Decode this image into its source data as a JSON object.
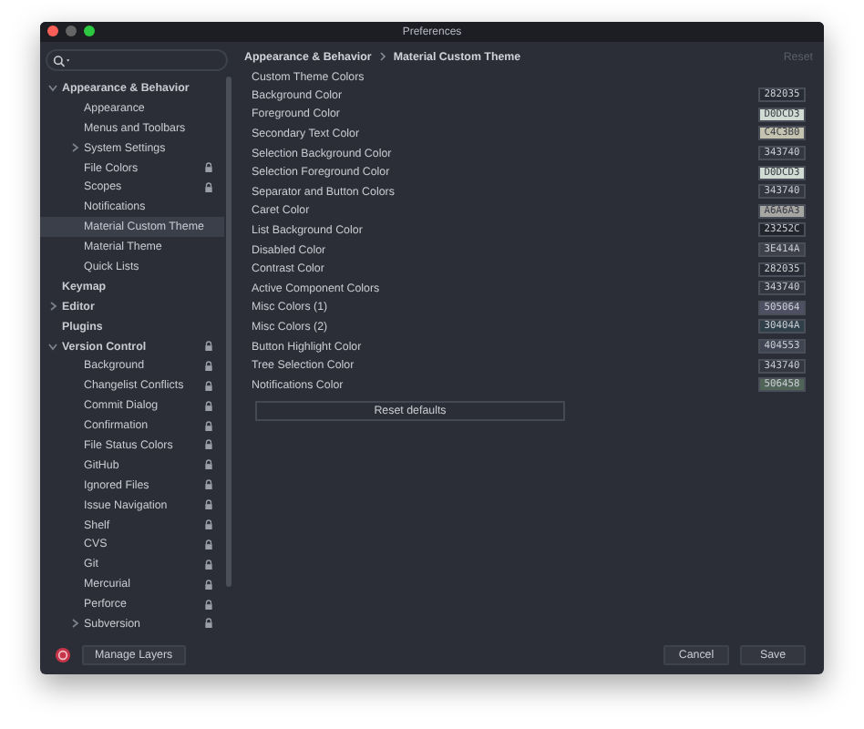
{
  "window": {
    "title": "Preferences"
  },
  "tree": [
    {
      "label": "Appearance & Behavior",
      "expanded": true,
      "selected": false,
      "shared": false,
      "children": [
        {
          "label": "Appearance",
          "selected": false,
          "shared": false
        },
        {
          "label": "Menus and Toolbars",
          "selected": false,
          "shared": false
        },
        {
          "label": "System Settings",
          "expanded": false,
          "selected": false,
          "shared": false
        },
        {
          "label": "File Colors",
          "selected": false,
          "shared": true
        },
        {
          "label": "Scopes",
          "selected": false,
          "shared": true
        },
        {
          "label": "Notifications",
          "selected": false,
          "shared": false
        },
        {
          "label": "Material Custom Theme",
          "selected": true,
          "shared": false
        },
        {
          "label": "Material Theme",
          "selected": false,
          "shared": false
        },
        {
          "label": "Quick Lists",
          "selected": false,
          "shared": false
        }
      ]
    },
    {
      "label": "Keymap",
      "selected": false,
      "shared": false
    },
    {
      "label": "Editor",
      "expanded": false,
      "selected": false,
      "shared": false
    },
    {
      "label": "Plugins",
      "selected": false,
      "shared": false
    },
    {
      "label": "Version Control",
      "expanded": true,
      "selected": false,
      "shared": true,
      "children": [
        {
          "label": "Background",
          "selected": false,
          "shared": true
        },
        {
          "label": "Changelist Conflicts",
          "selected": false,
          "shared": true
        },
        {
          "label": "Commit Dialog",
          "selected": false,
          "shared": true
        },
        {
          "label": "Confirmation",
          "selected": false,
          "shared": true
        },
        {
          "label": "File Status Colors",
          "selected": false,
          "shared": true
        },
        {
          "label": "GitHub",
          "selected": false,
          "shared": true
        },
        {
          "label": "Ignored Files",
          "selected": false,
          "shared": true
        },
        {
          "label": "Issue Navigation",
          "selected": false,
          "shared": true
        },
        {
          "label": "Shelf",
          "selected": false,
          "shared": true
        },
        {
          "label": "CVS",
          "selected": false,
          "shared": true
        },
        {
          "label": "Git",
          "selected": false,
          "shared": true
        },
        {
          "label": "Mercurial",
          "selected": false,
          "shared": true
        },
        {
          "label": "Perforce",
          "selected": false,
          "shared": true
        },
        {
          "label": "Subversion",
          "expanded": false,
          "selected": false,
          "shared": true
        }
      ]
    }
  ],
  "breadcrumb": [
    "Appearance & Behavior",
    "Material Custom Theme"
  ],
  "reset": {
    "label": "Reset",
    "disabled": true
  },
  "section_title": "Custom Theme Colors",
  "colors": [
    {
      "label": "Background Color",
      "value": "282035",
      "color": "#282d35"
    },
    {
      "label": "Foreground Color",
      "value": "D0DCD3",
      "color": "#d0dcd3"
    },
    {
      "label": "Secondary Text Color",
      "value": "C4C3B0",
      "color": "#c4c3b0"
    },
    {
      "label": "Selection Background Color",
      "value": "343740",
      "color": "#343740"
    },
    {
      "label": "Selection Foreground Color",
      "value": "D0DCD3",
      "color": "#d0dcd3"
    },
    {
      "label": "Separator and Button Colors",
      "value": "343740",
      "color": "#343740"
    },
    {
      "label": "Caret Color",
      "value": "A6A6A3",
      "color": "#a6a6a3"
    },
    {
      "label": "List Background Color",
      "value": "23252C",
      "color": "#23252c"
    },
    {
      "label": "Disabled Color",
      "value": "3E414A",
      "color": "#3e414a"
    },
    {
      "label": "Contrast Color",
      "value": "282035",
      "color": "#282d35"
    },
    {
      "label": "Active Component Colors",
      "value": "343740",
      "color": "#343740"
    },
    {
      "label": "Misc Colors (1)",
      "value": "505064",
      "color": "#505064"
    },
    {
      "label": "Misc Colors (2)",
      "value": "30404A",
      "color": "#30404a"
    },
    {
      "label": "Button Highlight Color",
      "value": "404553",
      "color": "#404553"
    },
    {
      "label": "Tree Selection Color",
      "value": "343740",
      "color": "#343740"
    },
    {
      "label": "Notifications Color",
      "value": "506458",
      "color": "#506458"
    }
  ],
  "reset_defaults": "Reset defaults",
  "footer": {
    "manage_layers": "Manage Layers",
    "cancel": "Cancel",
    "save": "Save"
  }
}
